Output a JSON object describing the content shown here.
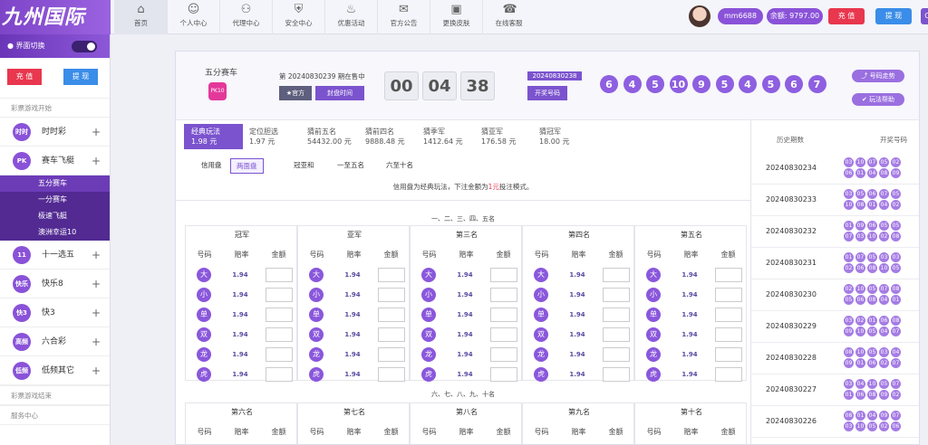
{
  "brand": {
    "logo_text": "九州国际"
  },
  "nav": [
    {
      "label": "首页",
      "icon": "home-icon"
    },
    {
      "label": "个人中心",
      "icon": "user-icon"
    },
    {
      "label": "代理中心",
      "icon": "users-icon"
    },
    {
      "label": "安全中心",
      "icon": "shield-icon"
    },
    {
      "label": "优惠活动",
      "icon": "fire-icon"
    },
    {
      "label": "官方公告",
      "icon": "announcement-icon"
    },
    {
      "label": "更换皮肤",
      "icon": "skin-icon"
    },
    {
      "label": "在线客服",
      "icon": "chat-icon"
    }
  ],
  "user": {
    "name": "mm6688",
    "balance": "余额: 9797.00",
    "deposit": "充 值",
    "withdraw": "提 现",
    "extra": "C"
  },
  "sidebar": {
    "switch_label": "界面切换",
    "deposit": "充 值",
    "withdraw": "提 现",
    "section_start": "彩票游戏开始",
    "section_end": "彩票游戏结束",
    "service": "服务中心",
    "items": [
      {
        "label": "时时彩",
        "badge": "时时"
      },
      {
        "label": "赛车飞艇",
        "badge": "PK"
      },
      {
        "label": "十一选五",
        "badge": "11"
      },
      {
        "label": "快乐8",
        "badge": "快乐"
      },
      {
        "label": "快3",
        "badge": "快3"
      },
      {
        "label": "六合彩",
        "badge": "高频"
      },
      {
        "label": "低频其它",
        "badge": "低频"
      }
    ],
    "sub": [
      "五分赛车",
      "一分赛车",
      "极速飞艇",
      "澳洲幸运10"
    ]
  },
  "game": {
    "name": "五分赛车",
    "issue_text": "第 20240830239 期在售中",
    "official": "★官方",
    "close_time": "封盘时间",
    "countdown": [
      "00",
      "04",
      "38"
    ],
    "last_issue": "20240830238",
    "draw_btn": "开奖号码",
    "balls": [
      "6",
      "4",
      "5",
      "10",
      "9",
      "5",
      "4",
      "5",
      "6",
      "7"
    ],
    "trend": "号码走势",
    "help": "玩法帮助"
  },
  "tabs": [
    {
      "name": "经典玩法",
      "val": "1.98 元"
    },
    {
      "name": "定位胆选",
      "val": "1.97 元"
    },
    {
      "name": "猜前五名",
      "val": "54432.00 元"
    },
    {
      "name": "猜前四名",
      "val": "9888.48 元"
    },
    {
      "name": "猜季军",
      "val": "1412.64 元"
    },
    {
      "name": "猜亚军",
      "val": "176.58 元"
    },
    {
      "name": "猜冠军",
      "val": "18.00 元"
    }
  ],
  "subtabs": [
    "信用盘",
    "两面盘",
    "冠亚和",
    "一至五名",
    "六至十名"
  ],
  "notice": {
    "pre": "信用盘为经典玩法，下注金额为",
    "hl": "1元",
    "post": "投注模式。"
  },
  "section1": "一、二、三、四、五名",
  "section2": "六、七、八、九、十名",
  "groups1": [
    "冠军",
    "亚军",
    "第三名",
    "第四名",
    "第五名"
  ],
  "groups2": [
    "第六名",
    "第七名",
    "第八名",
    "第九名",
    "第十名"
  ],
  "cols": [
    "号码",
    "赔率",
    "金额"
  ],
  "options": [
    "大",
    "小",
    "单",
    "双",
    "龙",
    "虎"
  ],
  "odds": "1.94",
  "history": {
    "head_issue": "历史期数",
    "head_nums": "开奖号码",
    "rows": [
      {
        "issue": "20240830234",
        "n": [
          "03",
          "10",
          "07",
          "05",
          "02",
          "06",
          "01",
          "04",
          "08",
          "09"
        ]
      },
      {
        "issue": "20240830233",
        "n": [
          "03",
          "05",
          "06",
          "07",
          "05",
          "10",
          "08",
          "01",
          "04",
          "02"
        ]
      },
      {
        "issue": "20240830232",
        "n": [
          "01",
          "09",
          "06",
          "05",
          "05",
          "07",
          "03",
          "10",
          "02",
          "08"
        ]
      },
      {
        "issue": "20240830231",
        "n": [
          "01",
          "07",
          "05",
          "03",
          "03",
          "02",
          "06",
          "08",
          "10",
          "05"
        ]
      },
      {
        "issue": "20240830230",
        "n": [
          "02",
          "10",
          "05",
          "07",
          "08",
          "05",
          "06",
          "08",
          "04",
          "01"
        ]
      },
      {
        "issue": "20240830229",
        "n": [
          "03",
          "02",
          "01",
          "06",
          "08",
          "09",
          "10",
          "05",
          "04",
          "07"
        ]
      },
      {
        "issue": "20240830228",
        "n": [
          "08",
          "10",
          "05",
          "03",
          "04",
          "09",
          "01",
          "06",
          "02",
          "07"
        ]
      },
      {
        "issue": "20240830227",
        "n": [
          "03",
          "04",
          "10",
          "05",
          "07",
          "01",
          "06",
          "08",
          "09",
          "02"
        ]
      },
      {
        "issue": "20240830226",
        "n": [
          "08",
          "01",
          "04",
          "09",
          "07",
          "03",
          "10",
          "05",
          "02",
          "06"
        ]
      }
    ]
  },
  "colors": {
    "purple": "#8a57dc",
    "red": "#e8374e",
    "blue": "#3a8de8"
  }
}
